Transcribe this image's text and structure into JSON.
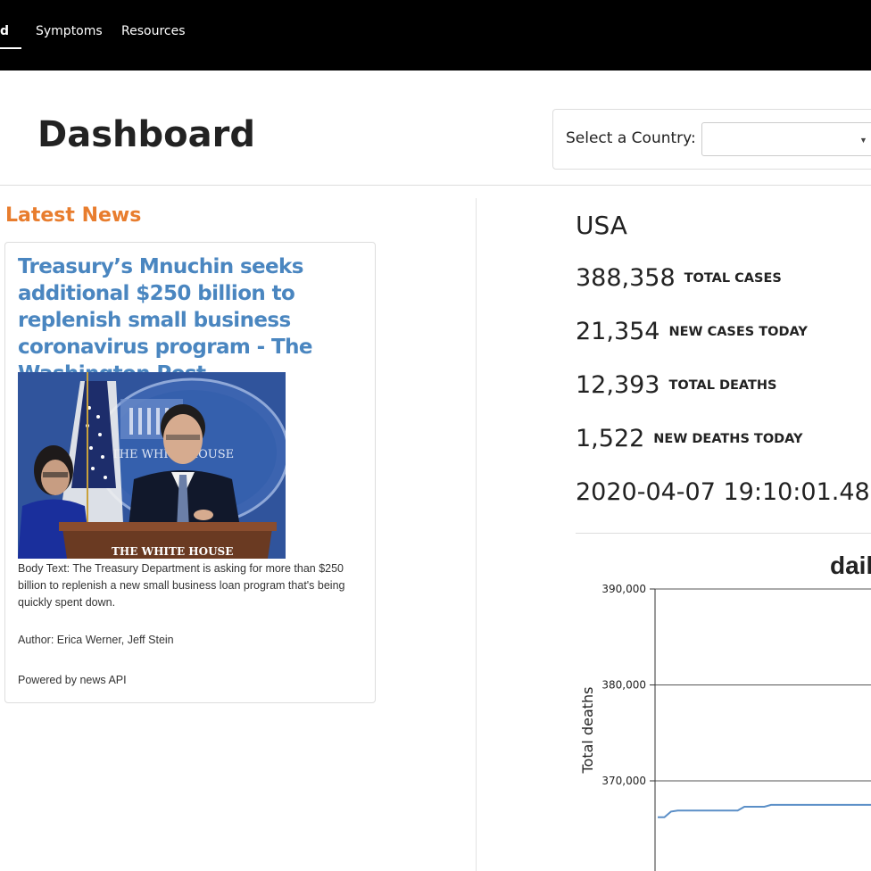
{
  "nav": {
    "items": [
      {
        "label": "d",
        "active": true
      },
      {
        "label": "Symptoms",
        "active": false
      },
      {
        "label": "Resources",
        "active": false
      }
    ]
  },
  "header": {
    "title": "Dashboard",
    "country_select_label": "Select a Country:",
    "country_select_value": ""
  },
  "news": {
    "heading": "Latest News",
    "article": {
      "title": "Treasury’s Mnuchin seeks additional $250 billion to replenish small business coronavirus program - The Washington Post",
      "image_caption": "THE WHITE HOUSE",
      "image_bg_text": "THE WHITE HOUSE",
      "body": "Body Text: The Treasury Department is asking for more than $250 billion to replenish a new small business loan program that's being quickly spent down.",
      "author": "Author: Erica Werner, Jeff Stein",
      "powered_by": "Powered by news API"
    }
  },
  "stats": {
    "country": "USA",
    "total_cases": {
      "value": "388,358",
      "label": "TOTAL CASES"
    },
    "new_cases": {
      "value": "21,354",
      "label": "NEW CASES TODAY"
    },
    "total_deaths": {
      "value": "12,393",
      "label": "TOTAL DEATHS"
    },
    "new_deaths": {
      "value": "1,522",
      "label": "NEW DEATHS TODAY"
    },
    "timestamp": "2020-04-07 19:10:01.485"
  },
  "colors": {
    "accent_orange": "#e87d2e",
    "link_blue": "#4a86c0",
    "nav_bg": "#000000",
    "series_line": "#5b8fc7"
  },
  "chart_data": {
    "type": "line",
    "title": "dail",
    "ylabel": "Total deaths",
    "ylim": [
      360000,
      390000
    ],
    "yticks": [
      370000,
      380000,
      390000
    ],
    "ytick_labels": [
      "370,000",
      "380,000",
      "390,000"
    ],
    "grid": true,
    "series": [
      {
        "values": [
          366200,
          366200,
          366800,
          366900,
          366900,
          366900,
          366900,
          366900,
          366900,
          366900,
          366900,
          366900,
          366900,
          367300,
          367300,
          367300,
          367300,
          367500,
          367500,
          367500,
          367500,
          367500,
          367500,
          367500,
          367500,
          367500,
          367500,
          367500,
          367500,
          367500,
          367500,
          367500,
          367500
        ]
      }
    ]
  }
}
